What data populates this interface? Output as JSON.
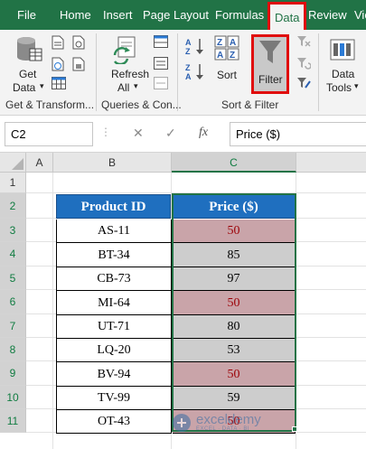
{
  "ribbon": {
    "tabs": [
      {
        "label": "File"
      },
      {
        "label": "Home"
      },
      {
        "label": "Insert"
      },
      {
        "label": "Page Layout"
      },
      {
        "label": "Formulas"
      },
      {
        "label": "Data"
      },
      {
        "label": "Review"
      },
      {
        "label": "Vie"
      }
    ],
    "active_tab": "Data",
    "buttons": {
      "get_data_line1": "Get",
      "get_data_line2": "Data",
      "refresh_line1": "Refresh",
      "refresh_line2": "All",
      "sort": "Sort",
      "filter": "Filter",
      "data_tools_line1": "Data",
      "data_tools_line2": "Tools"
    },
    "groups": {
      "get_transform": "Get & Transform...",
      "queries": "Queries & Con...",
      "sort_filter": "Sort & Filter"
    },
    "highlight_color": "#e00d0d"
  },
  "formula_bar": {
    "name_box": "C2",
    "fx": "fx",
    "content": "Price ($)"
  },
  "grid": {
    "columns": [
      "A",
      "B",
      "C"
    ],
    "rows": [
      "1",
      "2",
      "3",
      "4",
      "5",
      "6",
      "7",
      "8",
      "9",
      "10",
      "11"
    ],
    "selected_column": "C"
  },
  "table": {
    "headers": [
      "Product ID",
      "Price ($)"
    ],
    "header_color": "#1f6fbf",
    "highlight_fill": "#c9a4a9",
    "selection_fill": "#cdcdcd",
    "rows": [
      {
        "id": "AS-11",
        "price": "50",
        "highlighted": true
      },
      {
        "id": "BT-34",
        "price": "85",
        "highlighted": false
      },
      {
        "id": "CB-73",
        "price": "97",
        "highlighted": false
      },
      {
        "id": "MI-64",
        "price": "50",
        "highlighted": true
      },
      {
        "id": "UT-71",
        "price": "80",
        "highlighted": false
      },
      {
        "id": "LQ-20",
        "price": "53",
        "highlighted": false
      },
      {
        "id": "BV-94",
        "price": "50",
        "highlighted": true
      },
      {
        "id": "TV-99",
        "price": "59",
        "highlighted": false
      },
      {
        "id": "OT-43",
        "price": "50",
        "highlighted": true
      }
    ]
  },
  "watermark": {
    "name": "exceldemy",
    "tagline": "EXCEL · DATA · BI"
  }
}
